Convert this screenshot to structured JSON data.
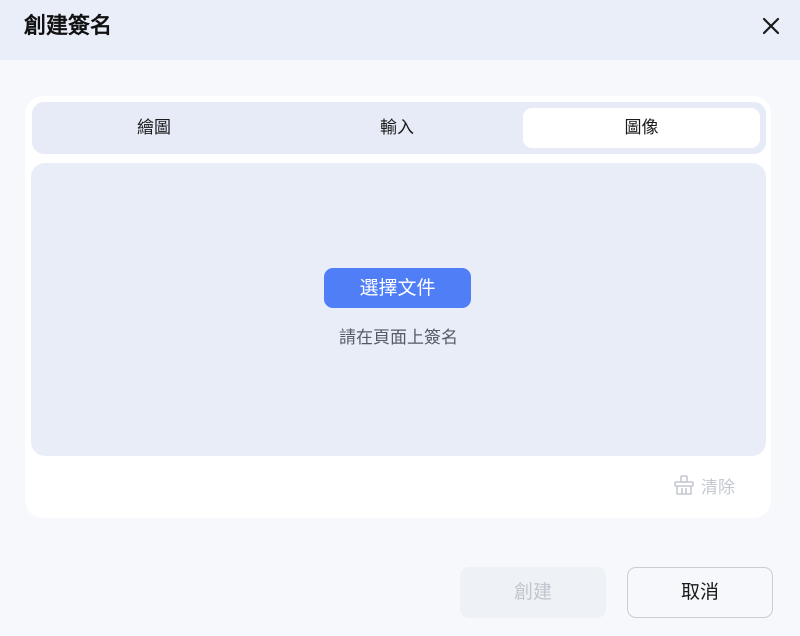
{
  "dialog": {
    "title": "創建簽名",
    "close_icon": "close-icon"
  },
  "tabs": [
    {
      "label": "繪圖",
      "active": false
    },
    {
      "label": "輸入",
      "active": false
    },
    {
      "label": "圖像",
      "active": true
    }
  ],
  "upload": {
    "choose_label": "選擇文件",
    "hint": "請在頁面上簽名"
  },
  "clear": {
    "label": "清除",
    "icon": "broom-icon",
    "enabled": false
  },
  "footer": {
    "create_label": "創建",
    "create_enabled": false,
    "cancel_label": "取消"
  },
  "colors": {
    "accent": "#4f7ef7",
    "header_bg": "#e9eef8",
    "disabled_text": "#c1c6cf"
  }
}
